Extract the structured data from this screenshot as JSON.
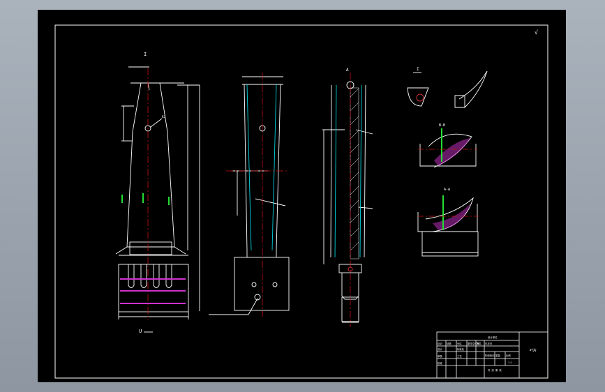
{
  "drawing": {
    "background": "#000000",
    "line_color": "#ffffff",
    "center_line_color": "#cc1111",
    "hidden_line_color": "#00d2dc",
    "accent_green": "#22dd33",
    "accent_magenta": "#cc33cc"
  },
  "roughness_symbol": "√",
  "section_marks": {
    "view1_top": "I",
    "view1_bottom": "U",
    "view3_top": "A",
    "detail1": "I",
    "section_bb": "B-B",
    "section_aa": "A-A"
  },
  "title_block": {
    "part_name": "叶片",
    "school": "设计单位",
    "row1": [
      "标记",
      "处数",
      "分区",
      "更改文件号",
      "签名",
      "年月日"
    ],
    "row2": [
      "设计",
      "",
      "标准化",
      ""
    ],
    "row3": [
      "审核",
      "",
      "工艺",
      "",
      "批准"
    ],
    "stage_labels": [
      "阶段标记",
      "重量",
      "比例"
    ],
    "scale": "1:1",
    "sheet_info": "共 张  第 张"
  }
}
